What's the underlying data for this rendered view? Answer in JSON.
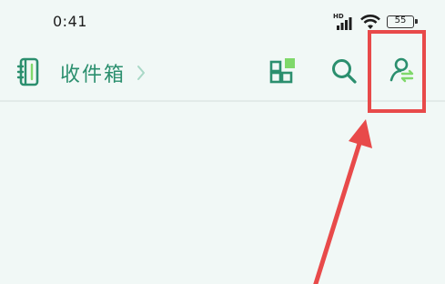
{
  "status_bar": {
    "time": "0:41",
    "network_label": "HD",
    "battery_level": "55"
  },
  "header": {
    "title": "收件箱"
  },
  "icons": {
    "notebook": "notebook-icon",
    "chevron": "chevron-right-icon",
    "apps": "apps-grid-icon",
    "search": "search-icon",
    "switch_user": "switch-user-icon"
  },
  "colors": {
    "background": "#f1f8f6",
    "accent": "#2b8f6e",
    "accent_light": "#7fd86a",
    "annotation": "#e84a4a"
  }
}
